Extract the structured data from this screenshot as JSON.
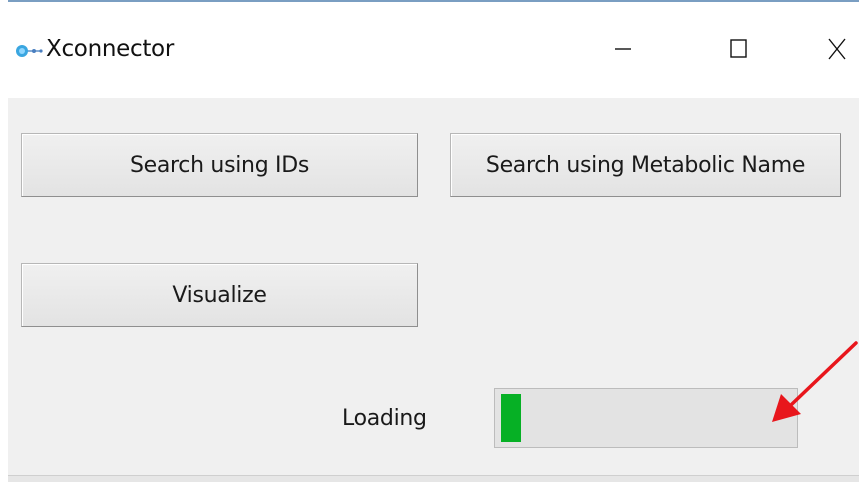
{
  "window": {
    "title": "Xconnector",
    "icon": "app-molecule-icon"
  },
  "title_buttons": {
    "minimize_icon": "minimize-icon",
    "maximize_icon": "maximize-icon",
    "close_icon": "close-icon"
  },
  "main": {
    "search_ids_label": "Search using IDs",
    "search_metabolic_label": "Search using Metabolic Name",
    "visualize_label": "Visualize",
    "loading_label": "Loading",
    "progress": 0.07
  },
  "annotation": {
    "arrow_color": "#e8161c",
    "icon": "red-arrow-icon"
  },
  "colors": {
    "progress_fill": "#06b025",
    "window_bg": "#f0f0f0",
    "titlebar_bg": "#ffffff"
  }
}
